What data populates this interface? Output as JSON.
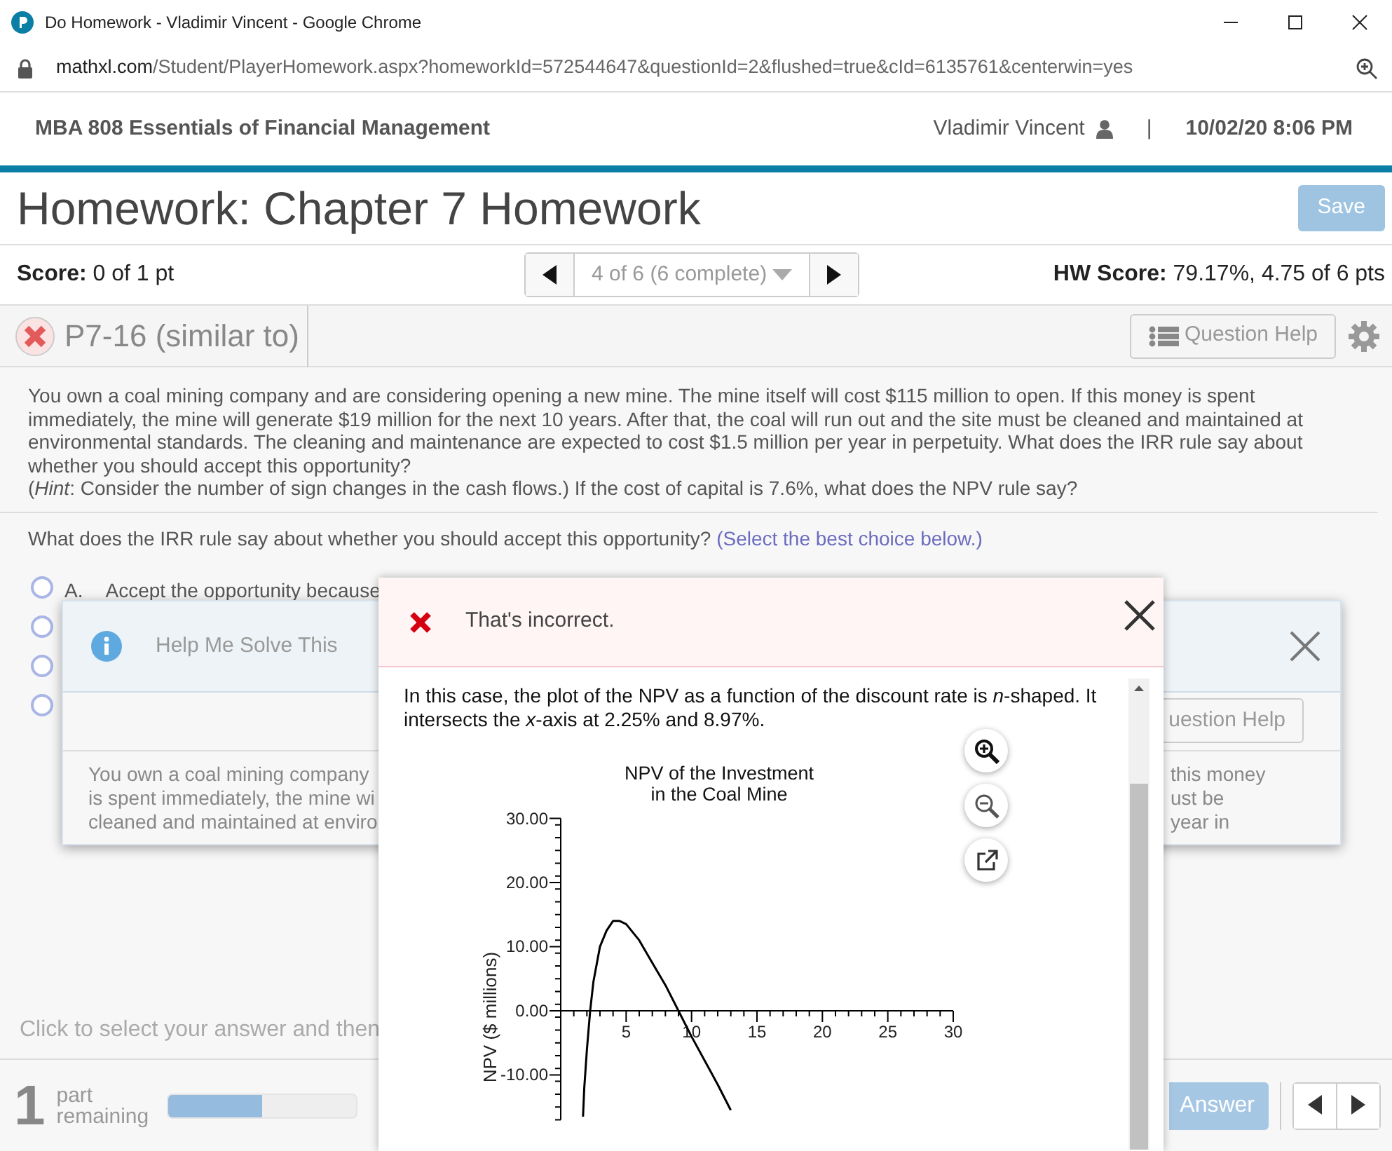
{
  "browser": {
    "title": "Do Homework - Vladimir Vincent - Google Chrome",
    "url_host": "mathxl.com",
    "url_path": "/Student/PlayerHomework.aspx?homeworkId=572544647&questionId=2&flushed=true&cId=6135761&centerwin=yes"
  },
  "header": {
    "course": "MBA 808 Essentials of Financial Management",
    "user": "Vladimir Vincent",
    "separator": "|",
    "datetime": "10/02/20 8:06 PM"
  },
  "title": "Homework: Chapter 7 Homework",
  "save_button": {
    "label": "Save",
    "disabled": true
  },
  "score": {
    "label": "Score:",
    "value": "0 of 1 pt"
  },
  "question_nav": {
    "position": "4 of 6 (6 complete)"
  },
  "hw_score": {
    "label": "HW Score:",
    "value": "79.17%, 4.75 of 6 pts"
  },
  "question": {
    "correct": false,
    "id": "P7-16 (similar to)",
    "help_button": "Question Help",
    "text": "You own a coal mining company and are considering opening a new mine. The mine itself will cost $115 million to open. If this money is spent immediately, the mine will generate $19 million for the next 10 years. After that, the coal will run out and the site must be cleaned and maintained at environmental standards. The cleaning and maintenance are expected to cost $1.5 million per year in perpetuity. What does the IRR rule say about whether you should accept this opportunity?",
    "hint": "(*Hint*: Consider the number of sign changes in the cash flows.) If the cost of capital is 7.6%, what does the NPV rule say?",
    "prompt": "What does the IRR rule say about whether you should accept this opportunity?",
    "prompt_note": "(Select the best choice below.)"
  },
  "options": [
    {
      "letter": "A.",
      "text": "Accept the opportunity because",
      "selected": false
    },
    {
      "selected": false
    },
    {
      "selected": false
    },
    {
      "selected": false
    }
  ],
  "instruction": "Click to select your answer and then",
  "footer": {
    "parts_count": "1",
    "parts_label": "part remaining",
    "level": 0.5,
    "check_button": "Answer"
  },
  "help_dialog": {
    "title": "Help Me Solve This",
    "help_button": "uestion Help",
    "text_lines": [
      "You own a coal mining company",
      "is spent immediately, the mine wi",
      "cleaned and maintained at enviro"
    ],
    "text_right": [
      "this money",
      "ust be",
      "year in"
    ]
  },
  "feedback": {
    "title": "That's incorrect.",
    "text": "In this case, the plot of the NPV as a function of the discount rate is *n*-shaped. It intersects the *x*-axis at 2.25% and 8.97%.",
    "chart_data": {
      "type": "line",
      "title": "NPV of the Investment in the Coal Mine",
      "ylabel": "NPV ($ millions)",
      "x": [
        1.7,
        1.8,
        2,
        2.25,
        2.5,
        3,
        3.5,
        4,
        4.5,
        5,
        6,
        7,
        8,
        9,
        10,
        12,
        13
      ],
      "values": [
        -16.5,
        -12,
        -6,
        0,
        4.5,
        10,
        12.5,
        14,
        14,
        13.5,
        11,
        7.5,
        4,
        0,
        -4,
        -11.5,
        -15.5
      ],
      "xlim": [
        0,
        30
      ],
      "ylim": [
        -17,
        30
      ],
      "xticks": [
        5,
        10,
        15,
        20,
        25,
        30
      ],
      "yticks": [
        {
          "value": 30,
          "label": "30.00"
        },
        {
          "value": 20,
          "label": "20.00"
        },
        {
          "value": 10,
          "label": "10.00"
        },
        {
          "value": 0,
          "label": "0.00"
        },
        {
          "value": -10,
          "label": "-10.00"
        }
      ]
    }
  }
}
